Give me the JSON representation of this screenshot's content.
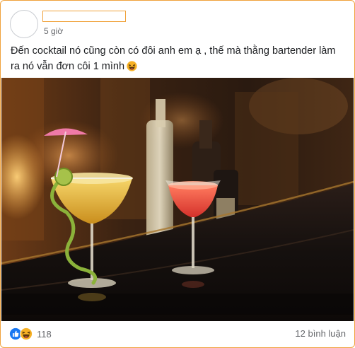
{
  "post": {
    "author_name": "",
    "timestamp": "5 giờ",
    "text": "Đến cocktail nó cũng còn có đôi anh em ạ , thế mà thằng bartender làm ra nó vẫn đơn côi 1 mình",
    "text_emoji": "laughing-emoji"
  },
  "photo": {
    "subject": "two cocktail glasses on a bar counter",
    "colors": {
      "warm_bg": "#4a2c17",
      "counter": "#1b1310",
      "drink_left": "#e0b23c",
      "drink_right": "#e8453a"
    }
  },
  "footer": {
    "reactions": [
      "like-icon",
      "haha-icon"
    ],
    "reaction_count": "118",
    "comments_label": "12 bình luận"
  },
  "colors": {
    "accent_border": "#f0a23b",
    "like_blue": "#1877f2",
    "haha_yellow": "#f7b125",
    "muted_text": "#65676b"
  }
}
